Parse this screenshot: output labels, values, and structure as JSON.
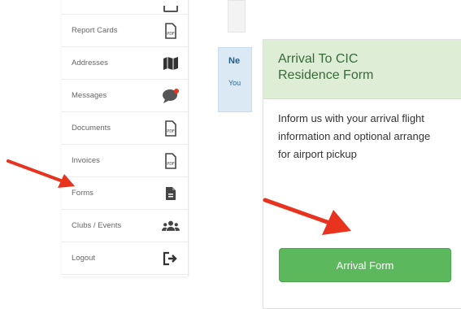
{
  "sidebar": {
    "items": [
      {
        "label": "Report Cards",
        "icon": "pdf-icon"
      },
      {
        "label": "Addresses",
        "icon": "map-icon"
      },
      {
        "label": "Messages",
        "icon": "chat-bubble-icon"
      },
      {
        "label": "Documents",
        "icon": "pdf-icon"
      },
      {
        "label": "Invoices",
        "icon": "pdf-icon"
      },
      {
        "label": "Forms",
        "icon": "form-document-icon"
      },
      {
        "label": "Clubs / Events",
        "icon": "users-group-icon"
      },
      {
        "label": "Logout",
        "icon": "logout-icon"
      }
    ]
  },
  "info_box": {
    "title": "Ne",
    "text": "You"
  },
  "form_card": {
    "title": "Arrival To CIC Residence Form",
    "description": "Inform us with your arrival flight information and optional arrange for airport pickup",
    "button_label": "Arrival Form"
  },
  "colors": {
    "card_header_bg": "#ddedd6",
    "button_green": "#5cb85c",
    "arrow_red": "#e8331f",
    "info_blue": "#dbe9f4"
  }
}
